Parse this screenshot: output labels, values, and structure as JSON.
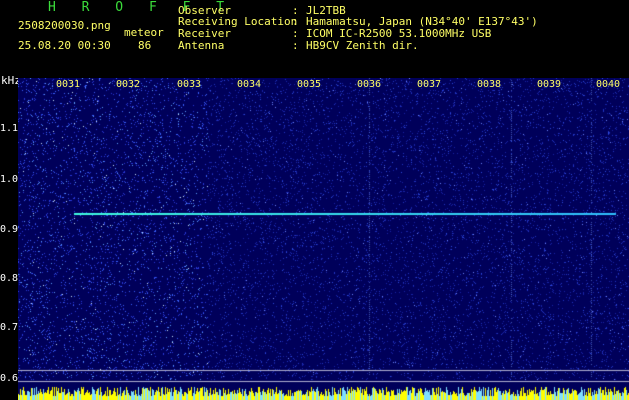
{
  "header": {
    "brand": "H R O F F T",
    "filename": "2508200030.png",
    "timestamp": "25.08.20 00:30",
    "type_label": "meteor",
    "count": "86"
  },
  "metadata": [
    {
      "label": "Observer",
      "value": "JL2TBB"
    },
    {
      "label": "Receiving Location",
      "value": "Hamamatsu, Japan (N34°40' E137°43')"
    },
    {
      "label": "Receiver",
      "value": "ICOM IC-R2500 53.1000MHz USB"
    },
    {
      "label": "Antenna",
      "value": "HB9CV Zenith dir."
    }
  ],
  "colors": {
    "background": "#000000",
    "waterfall_base": "#00005a",
    "signal": "#40ffe0",
    "labels": "#ffff66",
    "brand": "#3bdc3b"
  },
  "chart_data": {
    "type": "heatmap",
    "ylabel": "kHz",
    "y_ticks": [
      "1.1",
      "1.0",
      "0.9",
      "0.8",
      "0.7",
      "0.6"
    ],
    "x_ticks": [
      "0031",
      "0032",
      "0033",
      "0034",
      "0035",
      "0036",
      "0037",
      "0038",
      "0039",
      "0040"
    ],
    "ylim": [
      0.58,
      1.2
    ],
    "signal_trace": {
      "y_khz": 0.93,
      "x_start": "0031",
      "x_end": "0040"
    }
  }
}
